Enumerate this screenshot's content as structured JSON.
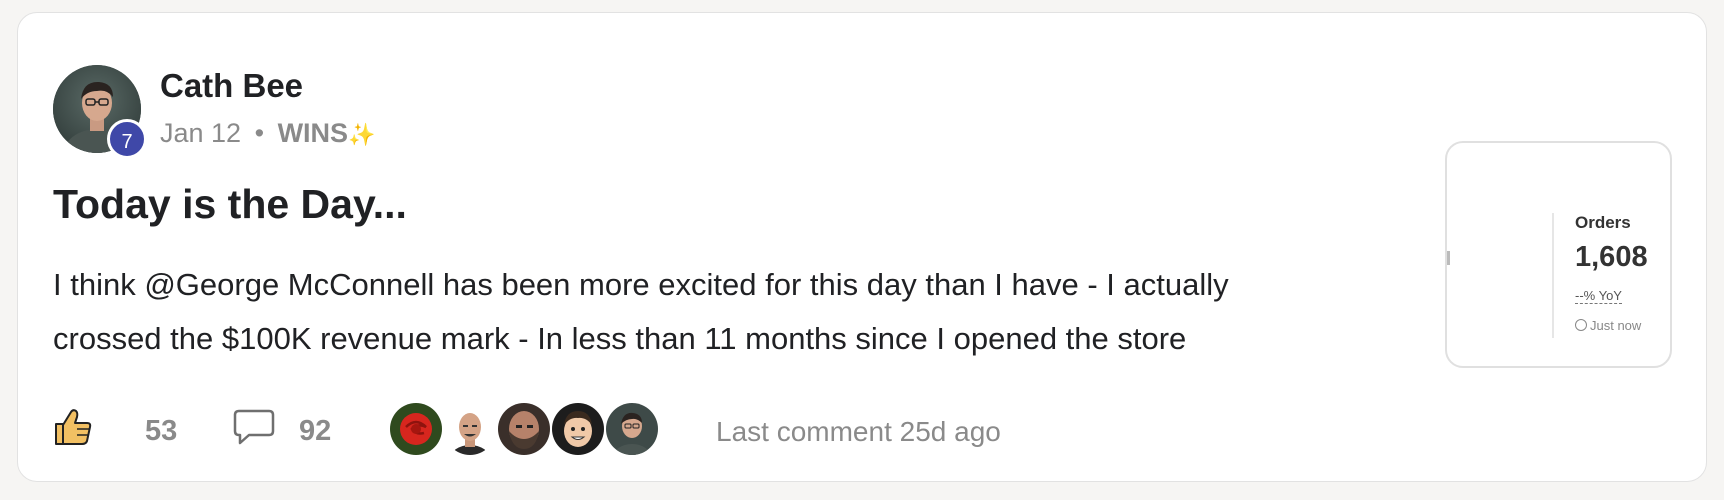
{
  "post": {
    "author": {
      "name": "Cath Bee",
      "level": "7"
    },
    "meta": {
      "date": "Jan 12",
      "separator": "•",
      "category": "WINS",
      "category_emoji": "✨"
    },
    "title": "Today is the Day...",
    "body_lines": [
      "I think @George McConnell has been more excited for this day than I have - I actually",
      "crossed the $100K revenue mark - In less than 11 months since I opened the store"
    ],
    "attachment": {
      "label": "Orders",
      "value": "1,608",
      "change": "--% YoY",
      "updated": "Just now"
    },
    "actions": {
      "likes": "53",
      "comments": "92",
      "last_comment": "Last comment 25d ago"
    },
    "commenters": [
      "rose-avatar",
      "bald-man-avatar",
      "bearded-man-avatar",
      "memoji-avatar",
      "woman-glasses-avatar"
    ]
  },
  "colors": {
    "level_badge": "#3f48a8",
    "like_icon": "#f2c063",
    "muted_text": "#8a8a8a"
  }
}
